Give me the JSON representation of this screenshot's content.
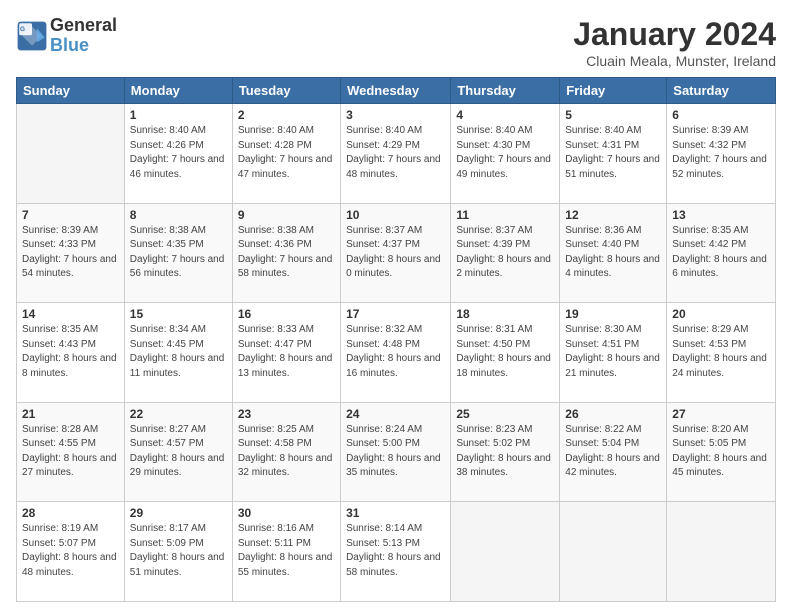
{
  "logo": {
    "line1": "General",
    "line2": "Blue"
  },
  "title": "January 2024",
  "location": "Cluain Meala, Munster, Ireland",
  "headers": [
    "Sunday",
    "Monday",
    "Tuesday",
    "Wednesday",
    "Thursday",
    "Friday",
    "Saturday"
  ],
  "weeks": [
    [
      {
        "day": "",
        "sunrise": "",
        "sunset": "",
        "daylight": ""
      },
      {
        "day": "1",
        "sunrise": "Sunrise: 8:40 AM",
        "sunset": "Sunset: 4:26 PM",
        "daylight": "Daylight: 7 hours and 46 minutes."
      },
      {
        "day": "2",
        "sunrise": "Sunrise: 8:40 AM",
        "sunset": "Sunset: 4:28 PM",
        "daylight": "Daylight: 7 hours and 47 minutes."
      },
      {
        "day": "3",
        "sunrise": "Sunrise: 8:40 AM",
        "sunset": "Sunset: 4:29 PM",
        "daylight": "Daylight: 7 hours and 48 minutes."
      },
      {
        "day": "4",
        "sunrise": "Sunrise: 8:40 AM",
        "sunset": "Sunset: 4:30 PM",
        "daylight": "Daylight: 7 hours and 49 minutes."
      },
      {
        "day": "5",
        "sunrise": "Sunrise: 8:40 AM",
        "sunset": "Sunset: 4:31 PM",
        "daylight": "Daylight: 7 hours and 51 minutes."
      },
      {
        "day": "6",
        "sunrise": "Sunrise: 8:39 AM",
        "sunset": "Sunset: 4:32 PM",
        "daylight": "Daylight: 7 hours and 52 minutes."
      }
    ],
    [
      {
        "day": "7",
        "sunrise": "Sunrise: 8:39 AM",
        "sunset": "Sunset: 4:33 PM",
        "daylight": "Daylight: 7 hours and 54 minutes."
      },
      {
        "day": "8",
        "sunrise": "Sunrise: 8:38 AM",
        "sunset": "Sunset: 4:35 PM",
        "daylight": "Daylight: 7 hours and 56 minutes."
      },
      {
        "day": "9",
        "sunrise": "Sunrise: 8:38 AM",
        "sunset": "Sunset: 4:36 PM",
        "daylight": "Daylight: 7 hours and 58 minutes."
      },
      {
        "day": "10",
        "sunrise": "Sunrise: 8:37 AM",
        "sunset": "Sunset: 4:37 PM",
        "daylight": "Daylight: 8 hours and 0 minutes."
      },
      {
        "day": "11",
        "sunrise": "Sunrise: 8:37 AM",
        "sunset": "Sunset: 4:39 PM",
        "daylight": "Daylight: 8 hours and 2 minutes."
      },
      {
        "day": "12",
        "sunrise": "Sunrise: 8:36 AM",
        "sunset": "Sunset: 4:40 PM",
        "daylight": "Daylight: 8 hours and 4 minutes."
      },
      {
        "day": "13",
        "sunrise": "Sunrise: 8:35 AM",
        "sunset": "Sunset: 4:42 PM",
        "daylight": "Daylight: 8 hours and 6 minutes."
      }
    ],
    [
      {
        "day": "14",
        "sunrise": "Sunrise: 8:35 AM",
        "sunset": "Sunset: 4:43 PM",
        "daylight": "Daylight: 8 hours and 8 minutes."
      },
      {
        "day": "15",
        "sunrise": "Sunrise: 8:34 AM",
        "sunset": "Sunset: 4:45 PM",
        "daylight": "Daylight: 8 hours and 11 minutes."
      },
      {
        "day": "16",
        "sunrise": "Sunrise: 8:33 AM",
        "sunset": "Sunset: 4:47 PM",
        "daylight": "Daylight: 8 hours and 13 minutes."
      },
      {
        "day": "17",
        "sunrise": "Sunrise: 8:32 AM",
        "sunset": "Sunset: 4:48 PM",
        "daylight": "Daylight: 8 hours and 16 minutes."
      },
      {
        "day": "18",
        "sunrise": "Sunrise: 8:31 AM",
        "sunset": "Sunset: 4:50 PM",
        "daylight": "Daylight: 8 hours and 18 minutes."
      },
      {
        "day": "19",
        "sunrise": "Sunrise: 8:30 AM",
        "sunset": "Sunset: 4:51 PM",
        "daylight": "Daylight: 8 hours and 21 minutes."
      },
      {
        "day": "20",
        "sunrise": "Sunrise: 8:29 AM",
        "sunset": "Sunset: 4:53 PM",
        "daylight": "Daylight: 8 hours and 24 minutes."
      }
    ],
    [
      {
        "day": "21",
        "sunrise": "Sunrise: 8:28 AM",
        "sunset": "Sunset: 4:55 PM",
        "daylight": "Daylight: 8 hours and 27 minutes."
      },
      {
        "day": "22",
        "sunrise": "Sunrise: 8:27 AM",
        "sunset": "Sunset: 4:57 PM",
        "daylight": "Daylight: 8 hours and 29 minutes."
      },
      {
        "day": "23",
        "sunrise": "Sunrise: 8:25 AM",
        "sunset": "Sunset: 4:58 PM",
        "daylight": "Daylight: 8 hours and 32 minutes."
      },
      {
        "day": "24",
        "sunrise": "Sunrise: 8:24 AM",
        "sunset": "Sunset: 5:00 PM",
        "daylight": "Daylight: 8 hours and 35 minutes."
      },
      {
        "day": "25",
        "sunrise": "Sunrise: 8:23 AM",
        "sunset": "Sunset: 5:02 PM",
        "daylight": "Daylight: 8 hours and 38 minutes."
      },
      {
        "day": "26",
        "sunrise": "Sunrise: 8:22 AM",
        "sunset": "Sunset: 5:04 PM",
        "daylight": "Daylight: 8 hours and 42 minutes."
      },
      {
        "day": "27",
        "sunrise": "Sunrise: 8:20 AM",
        "sunset": "Sunset: 5:05 PM",
        "daylight": "Daylight: 8 hours and 45 minutes."
      }
    ],
    [
      {
        "day": "28",
        "sunrise": "Sunrise: 8:19 AM",
        "sunset": "Sunset: 5:07 PM",
        "daylight": "Daylight: 8 hours and 48 minutes."
      },
      {
        "day": "29",
        "sunrise": "Sunrise: 8:17 AM",
        "sunset": "Sunset: 5:09 PM",
        "daylight": "Daylight: 8 hours and 51 minutes."
      },
      {
        "day": "30",
        "sunrise": "Sunrise: 8:16 AM",
        "sunset": "Sunset: 5:11 PM",
        "daylight": "Daylight: 8 hours and 55 minutes."
      },
      {
        "day": "31",
        "sunrise": "Sunrise: 8:14 AM",
        "sunset": "Sunset: 5:13 PM",
        "daylight": "Daylight: 8 hours and 58 minutes."
      },
      {
        "day": "",
        "sunrise": "",
        "sunset": "",
        "daylight": ""
      },
      {
        "day": "",
        "sunrise": "",
        "sunset": "",
        "daylight": ""
      },
      {
        "day": "",
        "sunrise": "",
        "sunset": "",
        "daylight": ""
      }
    ]
  ]
}
